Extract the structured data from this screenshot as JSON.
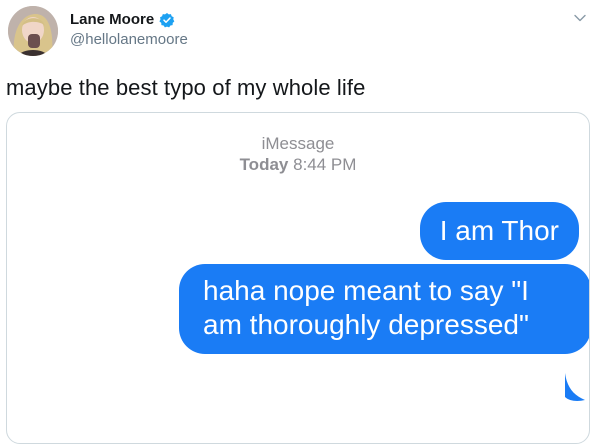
{
  "author": {
    "display_name": "Lane Moore",
    "handle": "@hellolanemoore",
    "verified": true
  },
  "tweet": {
    "text": "maybe the best typo of my whole life"
  },
  "media": {
    "service_label": "iMessage",
    "day": "Today",
    "time": "8:44 PM",
    "messages": [
      {
        "text": "I am Thor"
      },
      {
        "text": "haha nope meant to say \"I am thoroughly depressed\""
      }
    ]
  },
  "icons": {
    "verified": "verified-badge-icon",
    "more": "chevron-down-icon"
  },
  "colors": {
    "bubble_blue": "#1a7cf5",
    "verified_blue": "#1da1f2",
    "secondary_text": "#657786",
    "imessage_header_gray": "#8e8e93"
  }
}
